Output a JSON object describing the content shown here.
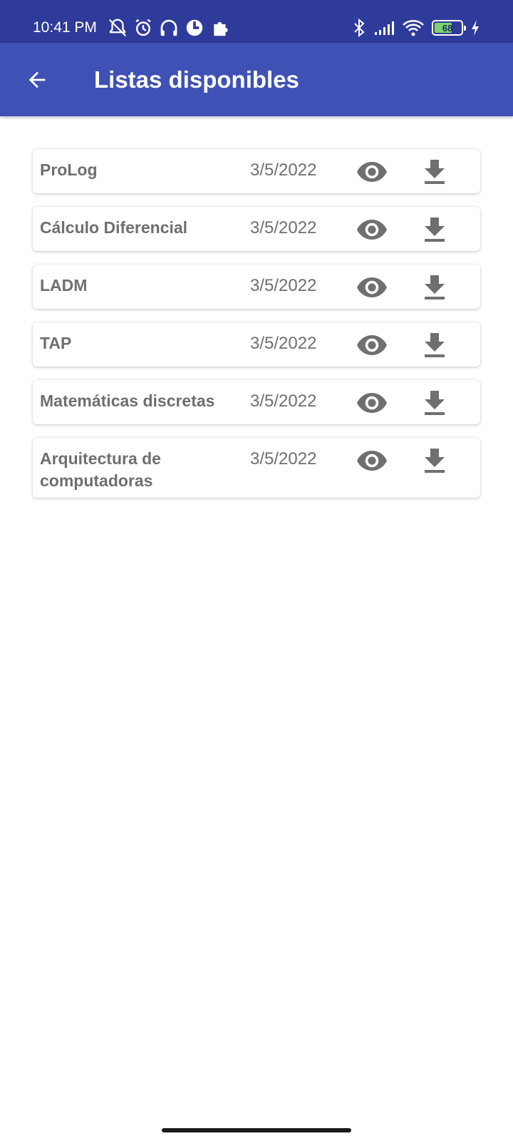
{
  "status_bar": {
    "time": "10:41 PM",
    "battery_level": "68",
    "battery_fraction": 0.68,
    "icons_left": [
      "mute-alarm-icon",
      "alarm-clock-icon",
      "headphones-icon",
      "app-icon",
      "puzzle-icon"
    ],
    "icons_right": [
      "bluetooth-icon",
      "signal-icon",
      "wifi-icon",
      "battery-icon",
      "charging-icon"
    ]
  },
  "app_bar": {
    "title": "Listas disponibles",
    "back_icon": "arrow-back-icon",
    "color": "#3f51b5",
    "status_color": "#2f3b9a"
  },
  "lists": [
    {
      "name": "ProLog",
      "date": "3/5/2022"
    },
    {
      "name": "Cálculo Diferencial",
      "date": "3/5/2022"
    },
    {
      "name": "LADM",
      "date": "3/5/2022"
    },
    {
      "name": "TAP",
      "date": "3/5/2022"
    },
    {
      "name": "Matemáticas discretas",
      "date": "3/5/2022"
    },
    {
      "name": "Arquitectura de computadoras",
      "date": "3/5/2022"
    }
  ],
  "item_icons": {
    "view": "eye-icon",
    "download": "download-icon",
    "color": "#6f6f6f"
  }
}
